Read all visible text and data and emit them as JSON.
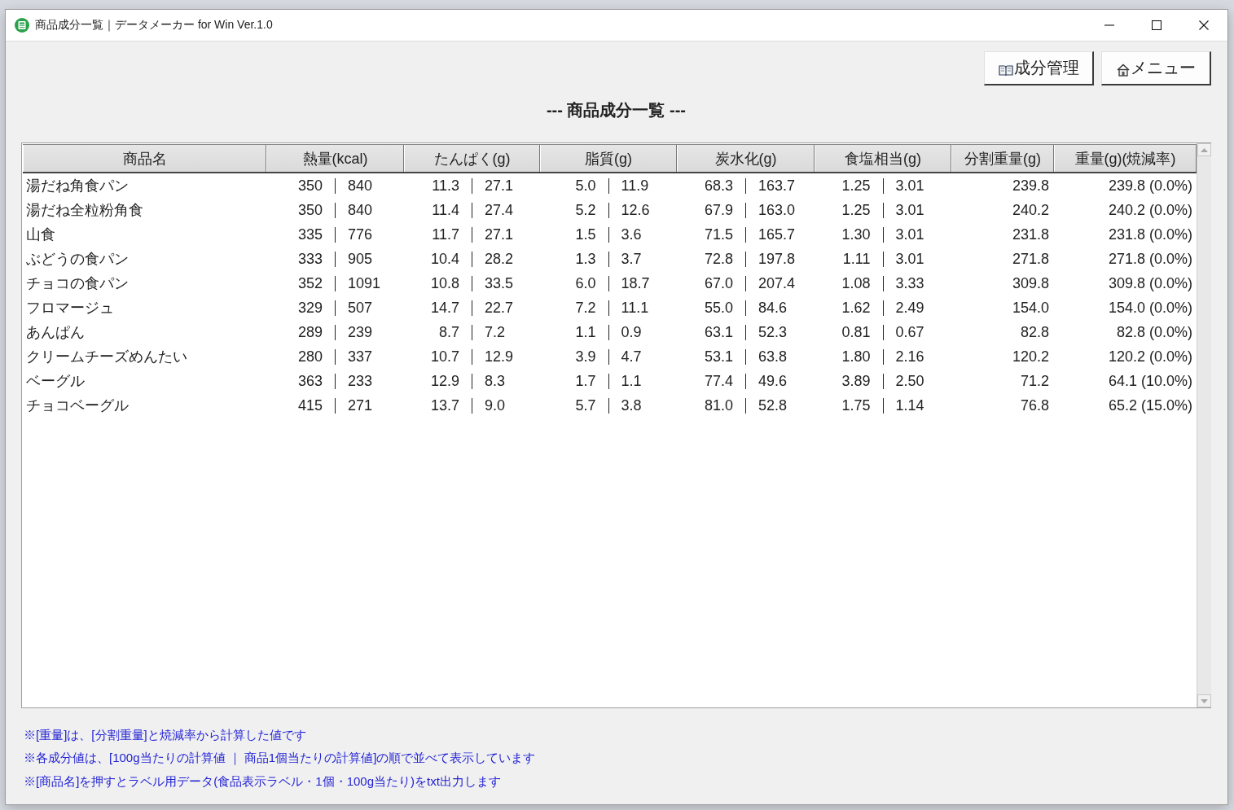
{
  "window": {
    "title": "商品成分一覧｜データメーカー for Win Ver.1.0"
  },
  "toolbar": {
    "buttons": [
      {
        "label": "成分管理",
        "kind": "manage"
      },
      {
        "label": "メニュー",
        "kind": "menu"
      }
    ]
  },
  "heading": "--- 商品成分一覧 ---",
  "table": {
    "columns": [
      "商品名",
      "熱量(kcal)",
      "たんぱく(g)",
      "脂質(g)",
      "炭水化(g)",
      "食塩相当(g)",
      "分割重量(g)",
      "重量(g)(焼減率)"
    ],
    "rows": [
      {
        "name": "湯だね角食パン",
        "nutrients": [
          {
            "per_100g": "350",
            "per_item": "840"
          },
          {
            "per_100g": "11.3",
            "per_item": "27.1"
          },
          {
            "per_100g": "5.0",
            "per_item": "11.9"
          },
          {
            "per_100g": "68.3",
            "per_item": "163.7"
          },
          {
            "per_100g": "1.25",
            "per_item": "3.01"
          }
        ],
        "split_weight": "239.8",
        "weight": "239.8 (0.0%)"
      },
      {
        "name": "湯だね全粒粉角食",
        "nutrients": [
          {
            "per_100g": "350",
            "per_item": "840"
          },
          {
            "per_100g": "11.4",
            "per_item": "27.4"
          },
          {
            "per_100g": "5.2",
            "per_item": "12.6"
          },
          {
            "per_100g": "67.9",
            "per_item": "163.0"
          },
          {
            "per_100g": "1.25",
            "per_item": "3.01"
          }
        ],
        "split_weight": "240.2",
        "weight": "240.2 (0.0%)"
      },
      {
        "name": "山食",
        "nutrients": [
          {
            "per_100g": "335",
            "per_item": "776"
          },
          {
            "per_100g": "11.7",
            "per_item": "27.1"
          },
          {
            "per_100g": "1.5",
            "per_item": "3.6"
          },
          {
            "per_100g": "71.5",
            "per_item": "165.7"
          },
          {
            "per_100g": "1.30",
            "per_item": "3.01"
          }
        ],
        "split_weight": "231.8",
        "weight": "231.8 (0.0%)"
      },
      {
        "name": "ぶどうの食パン",
        "nutrients": [
          {
            "per_100g": "333",
            "per_item": "905"
          },
          {
            "per_100g": "10.4",
            "per_item": "28.2"
          },
          {
            "per_100g": "1.3",
            "per_item": "3.7"
          },
          {
            "per_100g": "72.8",
            "per_item": "197.8"
          },
          {
            "per_100g": "1.11",
            "per_item": "3.01"
          }
        ],
        "split_weight": "271.8",
        "weight": "271.8 (0.0%)"
      },
      {
        "name": "チョコの食パン",
        "nutrients": [
          {
            "per_100g": "352",
            "per_item": "1091"
          },
          {
            "per_100g": "10.8",
            "per_item": "33.5"
          },
          {
            "per_100g": "6.0",
            "per_item": "18.7"
          },
          {
            "per_100g": "67.0",
            "per_item": "207.4"
          },
          {
            "per_100g": "1.08",
            "per_item": "3.33"
          }
        ],
        "split_weight": "309.8",
        "weight": "309.8 (0.0%)"
      },
      {
        "name": "フロマージュ",
        "nutrients": [
          {
            "per_100g": "329",
            "per_item": "507"
          },
          {
            "per_100g": "14.7",
            "per_item": "22.7"
          },
          {
            "per_100g": "7.2",
            "per_item": "11.1"
          },
          {
            "per_100g": "55.0",
            "per_item": "84.6"
          },
          {
            "per_100g": "1.62",
            "per_item": "2.49"
          }
        ],
        "split_weight": "154.0",
        "weight": "154.0 (0.0%)"
      },
      {
        "name": "あんぱん",
        "nutrients": [
          {
            "per_100g": "289",
            "per_item": "239"
          },
          {
            "per_100g": "8.7",
            "per_item": "7.2"
          },
          {
            "per_100g": "1.1",
            "per_item": "0.9"
          },
          {
            "per_100g": "63.1",
            "per_item": "52.3"
          },
          {
            "per_100g": "0.81",
            "per_item": "0.67"
          }
        ],
        "split_weight": "82.8",
        "weight": "82.8 (0.0%)"
      },
      {
        "name": "クリームチーズめんたい",
        "nutrients": [
          {
            "per_100g": "280",
            "per_item": "337"
          },
          {
            "per_100g": "10.7",
            "per_item": "12.9"
          },
          {
            "per_100g": "3.9",
            "per_item": "4.7"
          },
          {
            "per_100g": "53.1",
            "per_item": "63.8"
          },
          {
            "per_100g": "1.80",
            "per_item": "2.16"
          }
        ],
        "split_weight": "120.2",
        "weight": "120.2 (0.0%)"
      },
      {
        "name": "ベーグル",
        "nutrients": [
          {
            "per_100g": "363",
            "per_item": "233"
          },
          {
            "per_100g": "12.9",
            "per_item": "8.3"
          },
          {
            "per_100g": "1.7",
            "per_item": "1.1"
          },
          {
            "per_100g": "77.4",
            "per_item": "49.6"
          },
          {
            "per_100g": "3.89",
            "per_item": "2.50"
          }
        ],
        "split_weight": "71.2",
        "weight": "64.1 (10.0%)"
      },
      {
        "name": "チョコベーグル",
        "nutrients": [
          {
            "per_100g": "415",
            "per_item": "271"
          },
          {
            "per_100g": "13.7",
            "per_item": "9.0"
          },
          {
            "per_100g": "5.7",
            "per_item": "3.8"
          },
          {
            "per_100g": "81.0",
            "per_item": "52.8"
          },
          {
            "per_100g": "1.75",
            "per_item": "1.14"
          }
        ],
        "split_weight": "76.8",
        "weight": "65.2 (15.0%)"
      }
    ]
  },
  "notes": [
    "※[重量]は、[分割重量]と焼減率から計算した値です",
    "※各成分値は、[100g当たりの計算値 ｜ 商品1個当たりの計算値]の順で並べて表示しています",
    "※[商品名]を押すとラベル用データ(食品表示ラベル・1個・100g当たり)をtxt出力します"
  ]
}
